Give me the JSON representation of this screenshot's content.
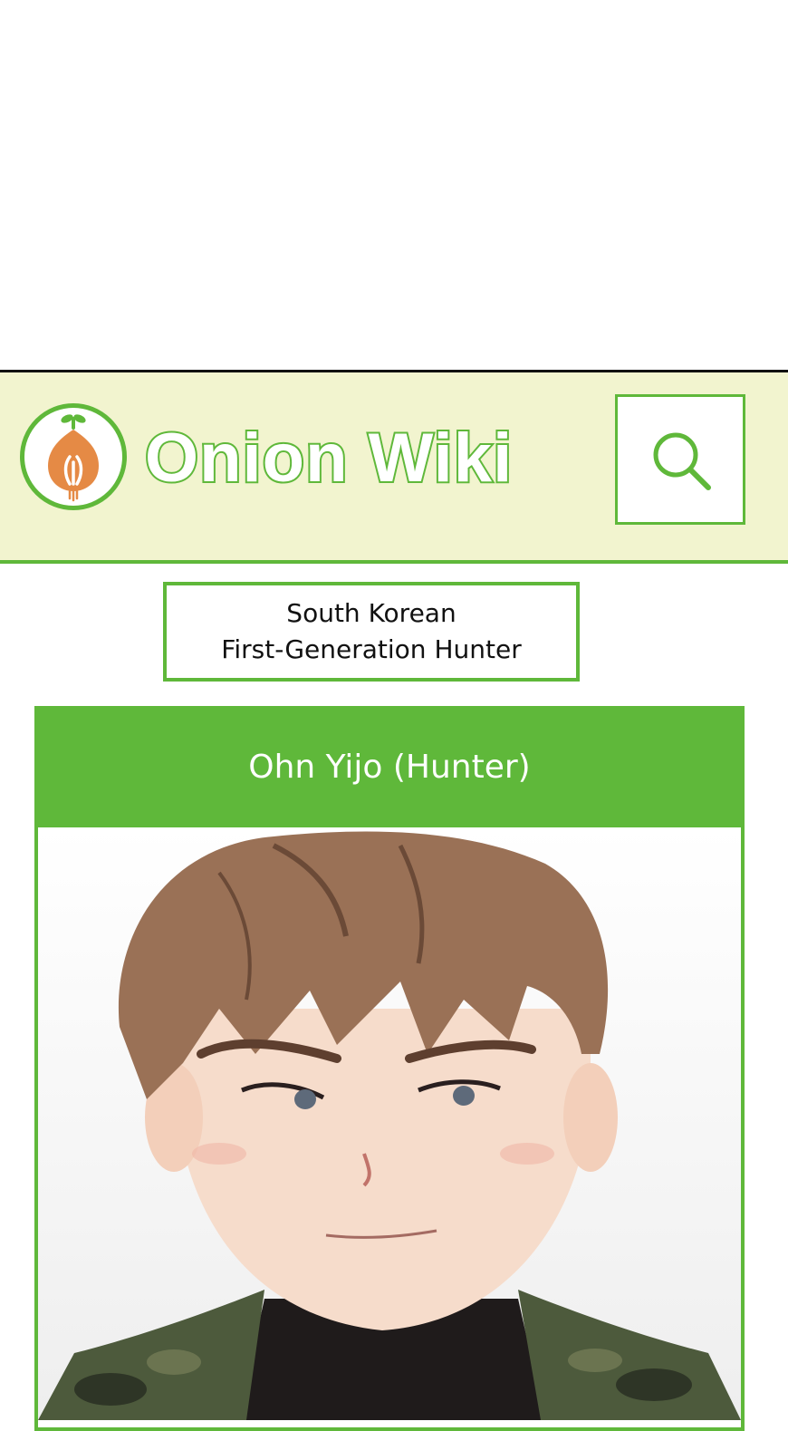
{
  "header": {
    "brand_name": "Onion Wiki",
    "logo_icon": "onion-icon",
    "search_icon": "search-icon",
    "accent_color": "#5fb83a",
    "background_color": "#f2f4cf"
  },
  "subtitle": {
    "line1": "South Korean",
    "line2": "First-Generation Hunter"
  },
  "infobox": {
    "title": "Ohn Yijo (Hunter)",
    "image": "character-portrait"
  }
}
